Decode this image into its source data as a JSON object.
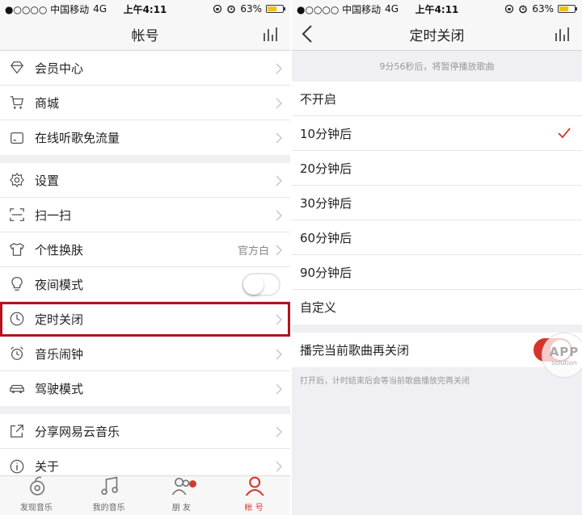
{
  "status": {
    "carrier": "●○○○○ 中国移动",
    "network": "4G",
    "time": "上午4:11",
    "battery": "63%",
    "battery_level": 0.63
  },
  "left": {
    "title": "帐号",
    "groups": [
      [
        {
          "label": "会员中心",
          "icon": "diamond-icon"
        },
        {
          "label": "商城",
          "icon": "cart-icon"
        },
        {
          "label": "在线听歌免流量",
          "icon": "sim-card-icon"
        }
      ],
      [
        {
          "label": "设置",
          "icon": "gear-icon"
        },
        {
          "label": "扫一扫",
          "icon": "scan-icon"
        },
        {
          "label": "个性换肤",
          "icon": "shirt-icon",
          "value": "官方白"
        },
        {
          "label": "夜间模式",
          "icon": "bulb-icon",
          "toggle": false
        },
        {
          "label": "定时关闭",
          "icon": "clock-icon",
          "highlighted": true
        },
        {
          "label": "音乐闹钟",
          "icon": "alarm-icon"
        },
        {
          "label": "驾驶模式",
          "icon": "car-icon"
        }
      ],
      [
        {
          "label": "分享网易云音乐",
          "icon": "share-icon"
        },
        {
          "label": "关于",
          "icon": "info-icon"
        }
      ]
    ],
    "tabs": [
      {
        "label": "发现音乐",
        "icon": "music-disc-icon",
        "active": false
      },
      {
        "label": "我的音乐",
        "icon": "music-note-icon",
        "active": false
      },
      {
        "label": "朋 友",
        "icon": "friends-icon",
        "active": false,
        "badge": true
      },
      {
        "label": "帐 号",
        "icon": "account-icon",
        "active": true
      }
    ]
  },
  "right": {
    "title": "定时关闭",
    "notice": "9分56秒后，将暂停播放歌曲",
    "options": [
      {
        "label": "不开启",
        "checked": false
      },
      {
        "label": "10分钟后",
        "checked": true
      },
      {
        "label": "20分钟后",
        "checked": false
      },
      {
        "label": "30分钟后",
        "checked": false
      },
      {
        "label": "60分钟后",
        "checked": false
      },
      {
        "label": "90分钟后",
        "checked": false
      },
      {
        "label": "自定义",
        "checked": false
      }
    ],
    "finish_song": {
      "label": "播完当前歌曲再关闭",
      "on": true
    },
    "footnote": "打开后，计时结束后会等当前歌曲播放完再关闭"
  },
  "watermark": {
    "main": "APP",
    "sub": "solution"
  },
  "colors": {
    "accent": "#d33a31",
    "highlight_border": "#b3131d",
    "toggle_on": "#d8332a"
  }
}
